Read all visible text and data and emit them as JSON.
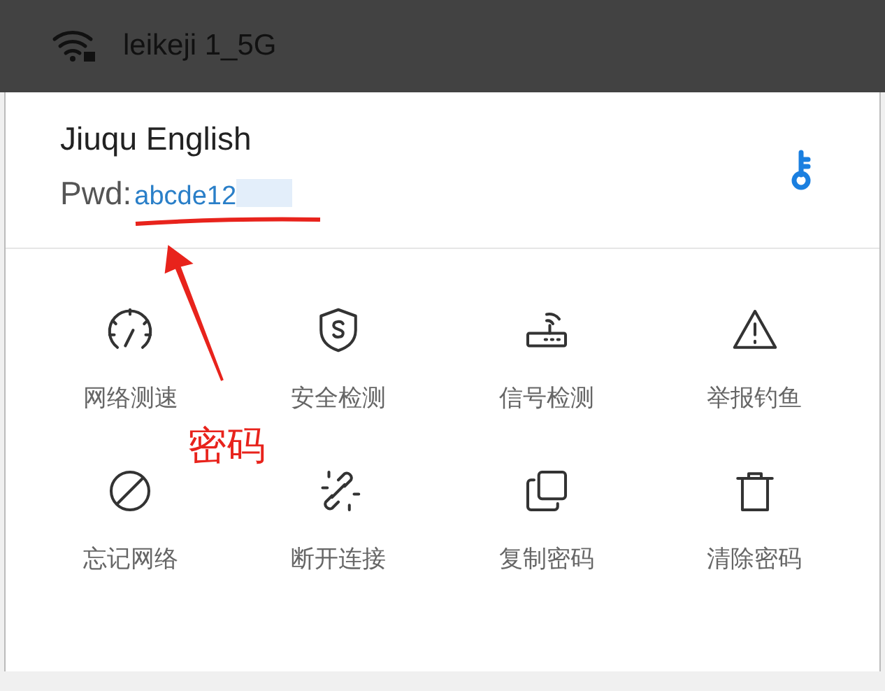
{
  "header": {
    "network": "leikeji 1_5G"
  },
  "network_card": {
    "name": "Jiuqu English",
    "password_label": "Pwd:",
    "password": "abcde12"
  },
  "actions": [
    {
      "kind": "speed",
      "label": "网络测速"
    },
    {
      "kind": "shield",
      "label": "安全检测"
    },
    {
      "kind": "router",
      "label": "信号检测"
    },
    {
      "kind": "warning",
      "label": "举报钓鱼"
    },
    {
      "kind": "forbid",
      "label": "忘记网络"
    },
    {
      "kind": "unlink",
      "label": "断开连接"
    },
    {
      "kind": "copy",
      "label": "复制密码"
    },
    {
      "kind": "trash",
      "label": "清除密码"
    }
  ],
  "annotation": {
    "label": "密码"
  }
}
